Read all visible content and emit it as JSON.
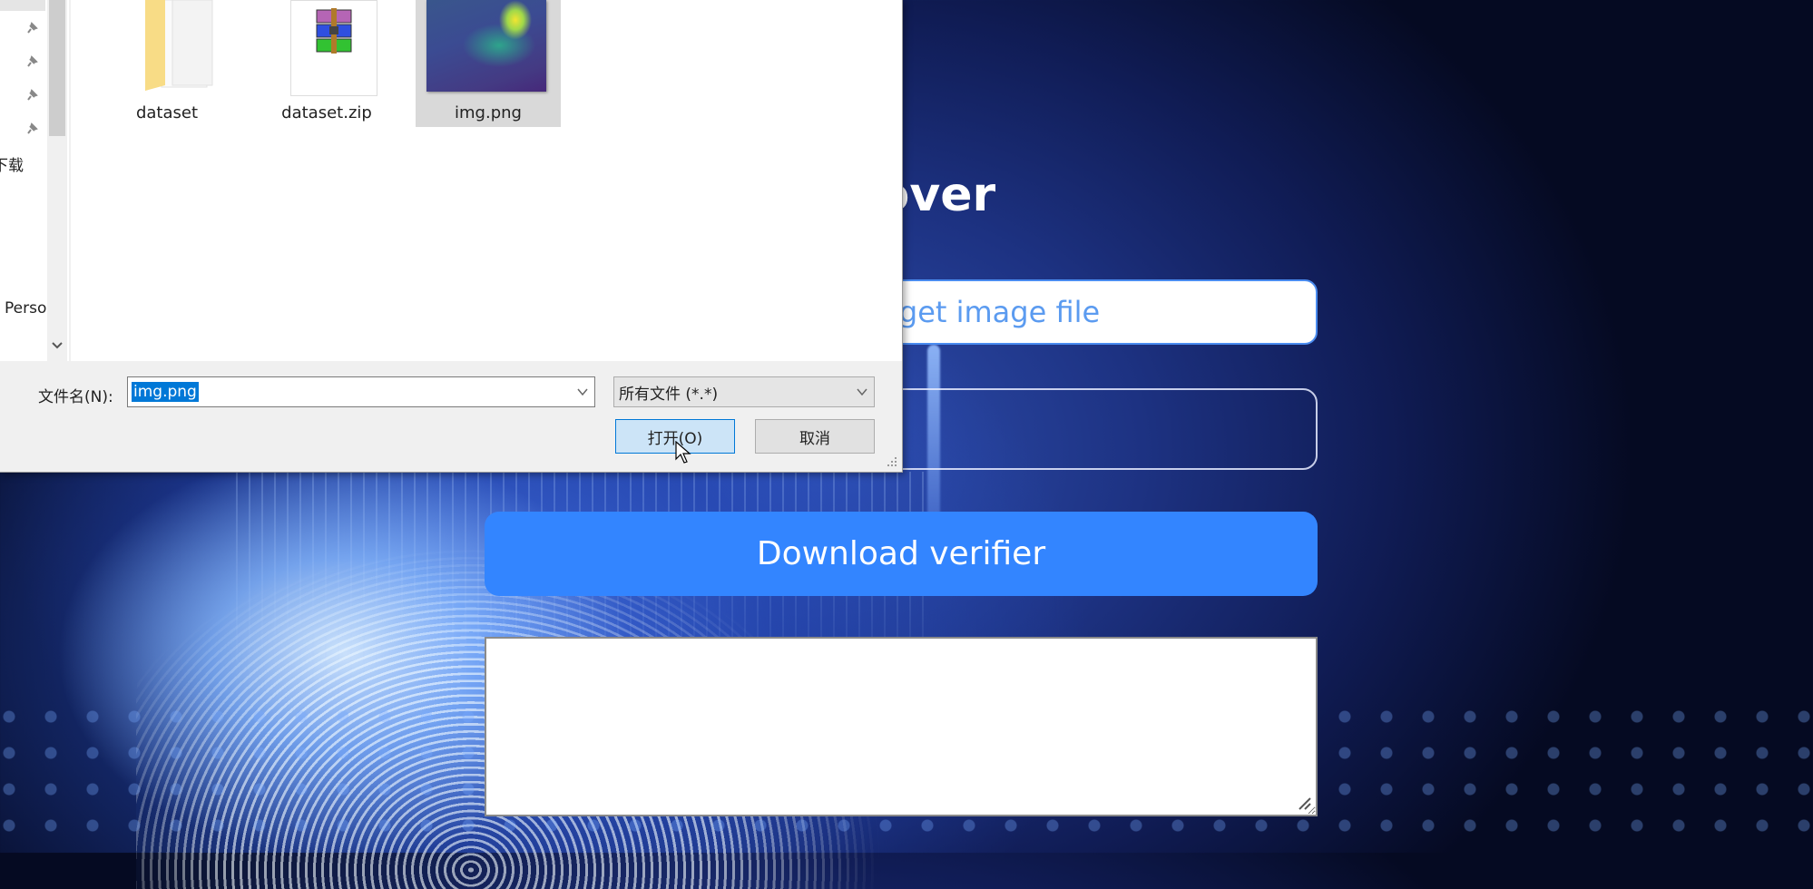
{
  "app": {
    "title": "Prover",
    "upload_button_label": "Upload target image file",
    "download_button_label": "Download verifier",
    "output_value": "",
    "colors": {
      "accent": "#3385ff",
      "upload_text": "#5b9bf0",
      "background_dark": "#0a1235"
    }
  },
  "file_dialog": {
    "nav_pane": {
      "items": [
        {
          "label": "",
          "pinned": true,
          "icon": "pin-icon"
        },
        {
          "label": "",
          "pinned": true,
          "icon": "pin-icon"
        },
        {
          "label": "",
          "pinned": true,
          "icon": "pin-icon"
        },
        {
          "label": "",
          "pinned": true,
          "icon": "pin-icon"
        },
        {
          "label": "下载"
        },
        {
          "label": "Perso"
        }
      ]
    },
    "files": [
      {
        "name": "dataset",
        "type": "folder",
        "icon": "folder-icon",
        "selected": false
      },
      {
        "name": "dataset.zip",
        "type": "archive",
        "icon": "zip-archive-icon",
        "selected": false
      },
      {
        "name": "img.png",
        "type": "image",
        "icon": "image-thumbnail",
        "selected": true
      }
    ],
    "filename_label": "文件名(N):",
    "filename_value": "img.png",
    "filetype_value": "所有文件 (*.*)",
    "open_button_label": "打开(O)",
    "cancel_button_label": "取消"
  }
}
